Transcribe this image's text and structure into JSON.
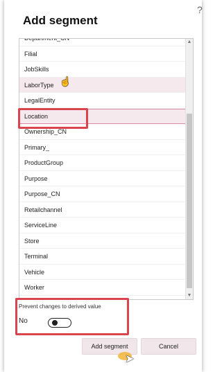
{
  "dialog": {
    "title": "Add segment",
    "help_glyph": "?"
  },
  "segments": {
    "items": [
      {
        "label": "Department_CN"
      },
      {
        "label": "Filial"
      },
      {
        "label": "JobSkills"
      },
      {
        "label": "LaborType"
      },
      {
        "label": "LegalEntity"
      },
      {
        "label": "Location"
      },
      {
        "label": "Ownership_CN"
      },
      {
        "label": "Primary_"
      },
      {
        "label": "ProductGroup"
      },
      {
        "label": "Purpose"
      },
      {
        "label": "Purpose_CN"
      },
      {
        "label": "Retailchannel"
      },
      {
        "label": "ServiceLine"
      },
      {
        "label": "Store"
      },
      {
        "label": "Terminal"
      },
      {
        "label": "Vehicle"
      },
      {
        "label": "Worker"
      }
    ],
    "selected": "Location",
    "hovered": "LaborType"
  },
  "derived_toggle": {
    "label": "Prevent changes to derived value",
    "state_text": "No",
    "checked": false
  },
  "buttons": {
    "add_label": "Add segment",
    "cancel_label": "Cancel"
  },
  "colors": {
    "highlight": "#d9444f",
    "selected_bg": "#f6e9ee",
    "button_bg": "#f1e6e9"
  }
}
